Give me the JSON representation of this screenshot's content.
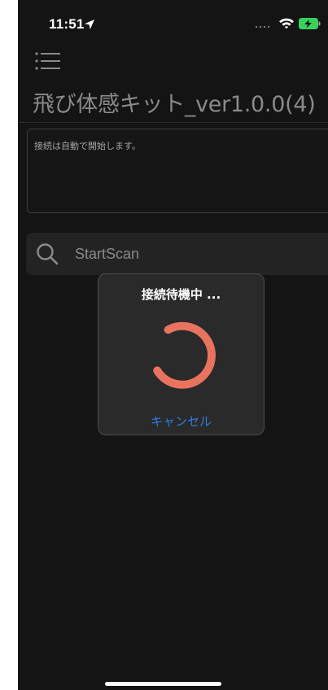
{
  "status_bar": {
    "time": "11:51",
    "icons": [
      "location-arrow-icon",
      "cellular-signal-icon",
      "wifi-icon",
      "battery-charging-icon"
    ]
  },
  "header": {
    "menu_icon": "hamburger-menu-icon",
    "title": "飛び体感キット_ver1.0.0(4)"
  },
  "log": {
    "text": "接続は自動で開始します。"
  },
  "scan": {
    "icon": "search-icon",
    "label": "StartScan"
  },
  "dialog": {
    "title": "接続待機中 ...",
    "spinner_color": "#e8735f",
    "cancel_label": "キャンセル",
    "cancel_color": "#2f7de1"
  },
  "colors": {
    "background": "#141414",
    "battery": "#38d15b",
    "accent_blue": "#2f7de1"
  }
}
